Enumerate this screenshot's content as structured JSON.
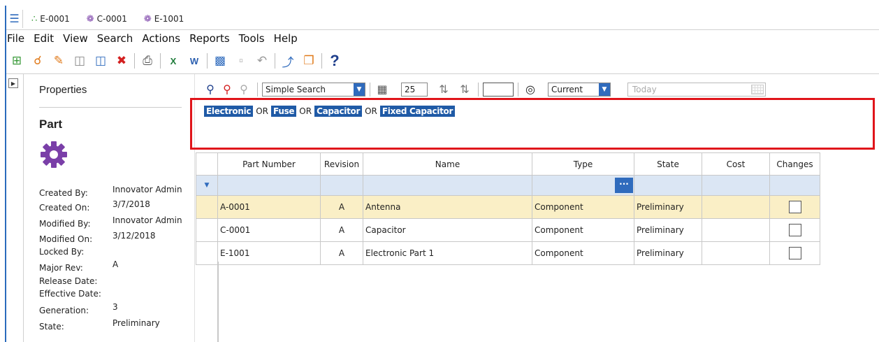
{
  "tabs": [
    {
      "label": "E-0001",
      "icon": "structure-icon"
    },
    {
      "label": "C-0001",
      "icon": "gear-icon"
    },
    {
      "label": "E-1001",
      "icon": "gear-icon"
    }
  ],
  "menu": [
    "File",
    "Edit",
    "View",
    "Search",
    "Actions",
    "Reports",
    "Tools",
    "Help"
  ],
  "properties": {
    "title": "Properties",
    "item_type": "Part",
    "fields": [
      {
        "label": "Created By:",
        "value": "Innovator Admin"
      },
      {
        "label": "Created On:",
        "value": "3/7/2018"
      },
      {
        "label": "Modified By:",
        "value": "Innovator Admin"
      },
      {
        "label": "Modified On:",
        "value": "3/12/2018"
      },
      {
        "label": "Locked By:",
        "value": ""
      },
      {
        "label": "Major Rev:",
        "value": "A"
      },
      {
        "label": "Release Date:",
        "value": ""
      },
      {
        "label": "Effective Date:",
        "value": ""
      },
      {
        "label": "Generation:",
        "value": "3"
      },
      {
        "label": "State:",
        "value": "Preliminary"
      }
    ]
  },
  "search": {
    "mode": "Simple Search",
    "page_size": "25",
    "version": "Current",
    "date_placeholder": "Today"
  },
  "criteria": [
    "Electronic",
    "OR",
    "Fuse",
    "OR",
    "Capacitor",
    "OR",
    "Fixed Capacitor"
  ],
  "grid": {
    "columns": [
      "Part Number",
      "Revision",
      "Name",
      "Type",
      "State",
      "Cost",
      "Changes"
    ],
    "rows": [
      {
        "part_number": "A-0001",
        "revision": "A",
        "name": "Antenna",
        "type": "Component",
        "state": "Preliminary",
        "cost": ""
      },
      {
        "part_number": "C-0001",
        "revision": "A",
        "name": "Capacitor",
        "type": "Component",
        "state": "Preliminary",
        "cost": ""
      },
      {
        "part_number": "E-1001",
        "revision": "A",
        "name": "Electronic Part 1",
        "type": "Component",
        "state": "Preliminary",
        "cost": ""
      }
    ]
  },
  "colors": {
    "accent": "#2f6bbd",
    "highlight": "#e0151b",
    "chip": "#1f5aa6",
    "selected_row": "#faefc6",
    "filter_row": "#dbe6f4"
  }
}
